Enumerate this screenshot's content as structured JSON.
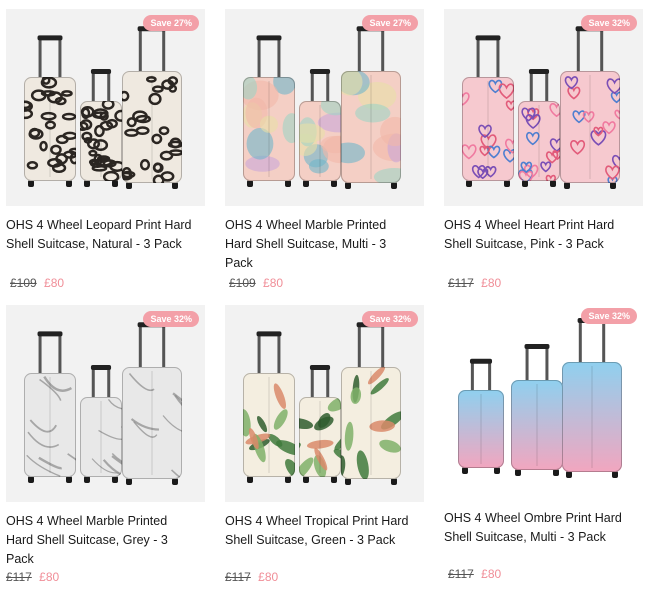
{
  "products": [
    {
      "title": "OHS 4 Wheel Leopard Print Hard Shell Suitcase, Natural - 3 Pack",
      "badge": "Save 27%",
      "was": "£109",
      "now": "£80",
      "pattern": "leopard",
      "colors": {
        "base": "#efe9e0",
        "accent": "#2b2622"
      }
    },
    {
      "title": "OHS 4 Wheel Marble Printed Hard Shell Suitcase, Multi - 3 Pack",
      "badge": "Save 27%",
      "was": "£109",
      "now": "£80",
      "pattern": "watercolor",
      "colors": {
        "base": "#f4cfc5",
        "accent": "#6fb6c9"
      }
    },
    {
      "title": "OHS 4 Wheel Heart Print Hard Shell Suitcase, Pink - 3 Pack",
      "badge": "Save 32%",
      "was": "£117",
      "now": "£80",
      "pattern": "hearts",
      "colors": {
        "base": "#f6c9cf",
        "accent": "#7b4fb6"
      }
    },
    {
      "title": "OHS 4 Wheel Marble Printed Hard Shell Suitcase, Grey - 3 Pack",
      "badge": "Save 32%",
      "was": "£117",
      "now": "£80",
      "pattern": "marble",
      "colors": {
        "base": "#e8e8e8",
        "accent": "#8a8a8a"
      }
    },
    {
      "title": "OHS 4 Wheel Tropical Print Hard Shell Suitcase, Green - 3 Pack",
      "badge": "Save 32%",
      "was": "£117",
      "now": "£80",
      "pattern": "tropical",
      "colors": {
        "base": "#f4eee0",
        "accent": "#3f7a3c"
      }
    },
    {
      "title": "OHS 4 Wheel Ombre Print Hard Shell Suitcase, Multi - 3 Pack",
      "badge": "Save 32%",
      "was": "£117",
      "now": "£80",
      "pattern": "ombre",
      "colors": {
        "base": "#8fd0ef",
        "accent": "#f2a6bf"
      }
    }
  ]
}
